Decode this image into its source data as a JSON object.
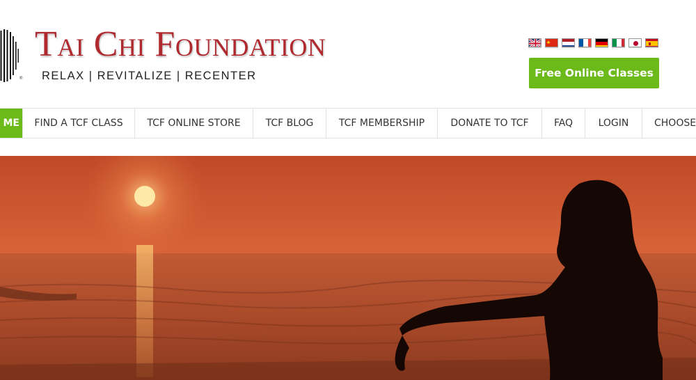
{
  "header": {
    "logo_title": "Tai Chi Foundation",
    "tagline": "RELAX | REVITALIZE | RECENTER",
    "cta_label": "Free Online Classes"
  },
  "languages": [
    {
      "code": "en",
      "icon": "uk-flag-icon"
    },
    {
      "code": "zh",
      "icon": "china-flag-icon"
    },
    {
      "code": "nl",
      "icon": "netherlands-flag-icon"
    },
    {
      "code": "fr",
      "icon": "france-flag-icon"
    },
    {
      "code": "de",
      "icon": "germany-flag-icon"
    },
    {
      "code": "it",
      "icon": "italy-flag-icon"
    },
    {
      "code": "ja",
      "icon": "japan-flag-icon"
    },
    {
      "code": "es",
      "icon": "spain-flag-icon"
    }
  ],
  "nav": {
    "items": [
      {
        "label": "ME",
        "active": true
      },
      {
        "label": "FIND A TCF CLASS"
      },
      {
        "label": "TCF ONLINE STORE"
      },
      {
        "label": "TCF BLOG"
      },
      {
        "label": "TCF MEMBERSHIP"
      },
      {
        "label": "DONATE TO TCF"
      },
      {
        "label": "FAQ"
      },
      {
        "label": "LOGIN"
      },
      {
        "label": "CHOOSE"
      }
    ]
  },
  "hero": {
    "image": "sunset-beach-tai-chi-photo"
  },
  "colors": {
    "brand_red": "#b0292f",
    "accent_green": "#6cba19",
    "nav_text": "#333333"
  }
}
